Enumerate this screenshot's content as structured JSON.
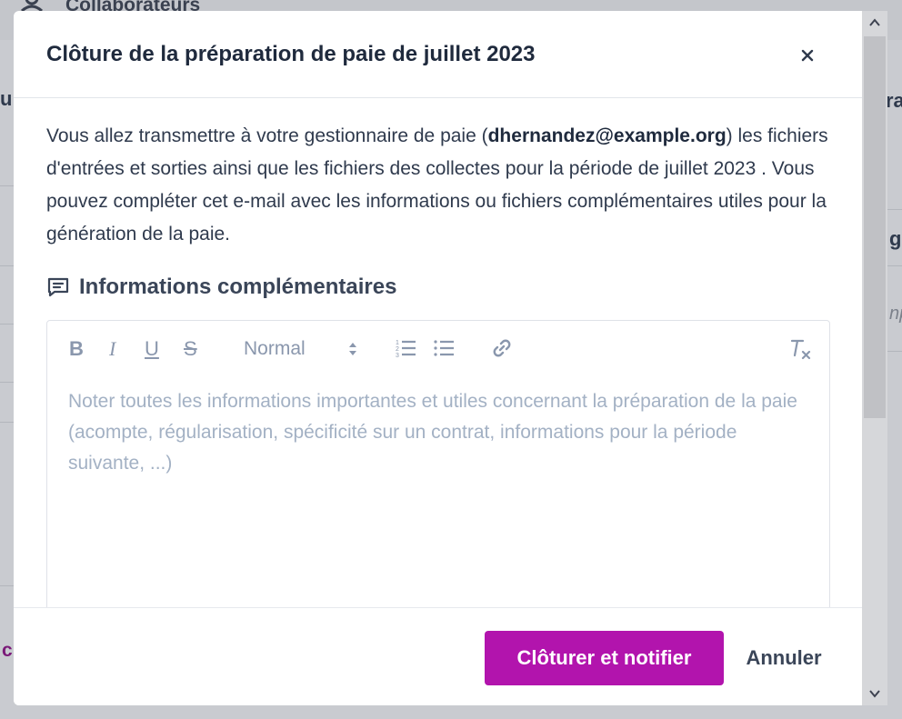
{
  "background": {
    "topnav_label": "Collaborateurs",
    "left_fragment_text": "u",
    "left_bottom_text": "c",
    "right_fragments": [
      "ra",
      "g",
      "np"
    ]
  },
  "modal": {
    "title": "Clôture de la préparation de paie de juillet 2023",
    "intro_before": "Vous allez transmettre à votre gestionnaire de paie (",
    "intro_email": "dhernandez@example.org",
    "intro_after": ") les fichiers d'entrées et sorties ainsi que les fichiers des collectes pour la période de juillet 2023 . Vous pouvez compléter cet e-mail avec les informations ou fichiers complémentaires utiles pour la génération de la paie.",
    "section_title": "Informations complémentaires",
    "editor": {
      "toolbar": {
        "bold": "B",
        "italic": "I",
        "underline": "U",
        "strike": "S",
        "format_select": "Normal"
      },
      "placeholder": "Noter toutes les informations importantes et utiles concernant la préparation de la paie (acompte, régularisation, spécificité sur un contrat, informations pour la période suivante, ...)"
    },
    "footer": {
      "primary_label": "Clôturer et notifier",
      "secondary_label": "Annuler"
    }
  },
  "colors": {
    "primary": "#b214ad",
    "overlay": "#c9cbd0",
    "placeholder": "#a3b1c4",
    "toolbar_icon": "#8a97ad"
  },
  "icons": [
    "users-icon",
    "close-icon",
    "comment-icon",
    "bold-icon",
    "italic-icon",
    "underline-icon",
    "strike-icon",
    "select-arrows-icon",
    "ordered-list-icon",
    "bullet-list-icon",
    "link-icon",
    "clear-format-icon",
    "scroll-up-icon",
    "scroll-down-icon"
  ]
}
